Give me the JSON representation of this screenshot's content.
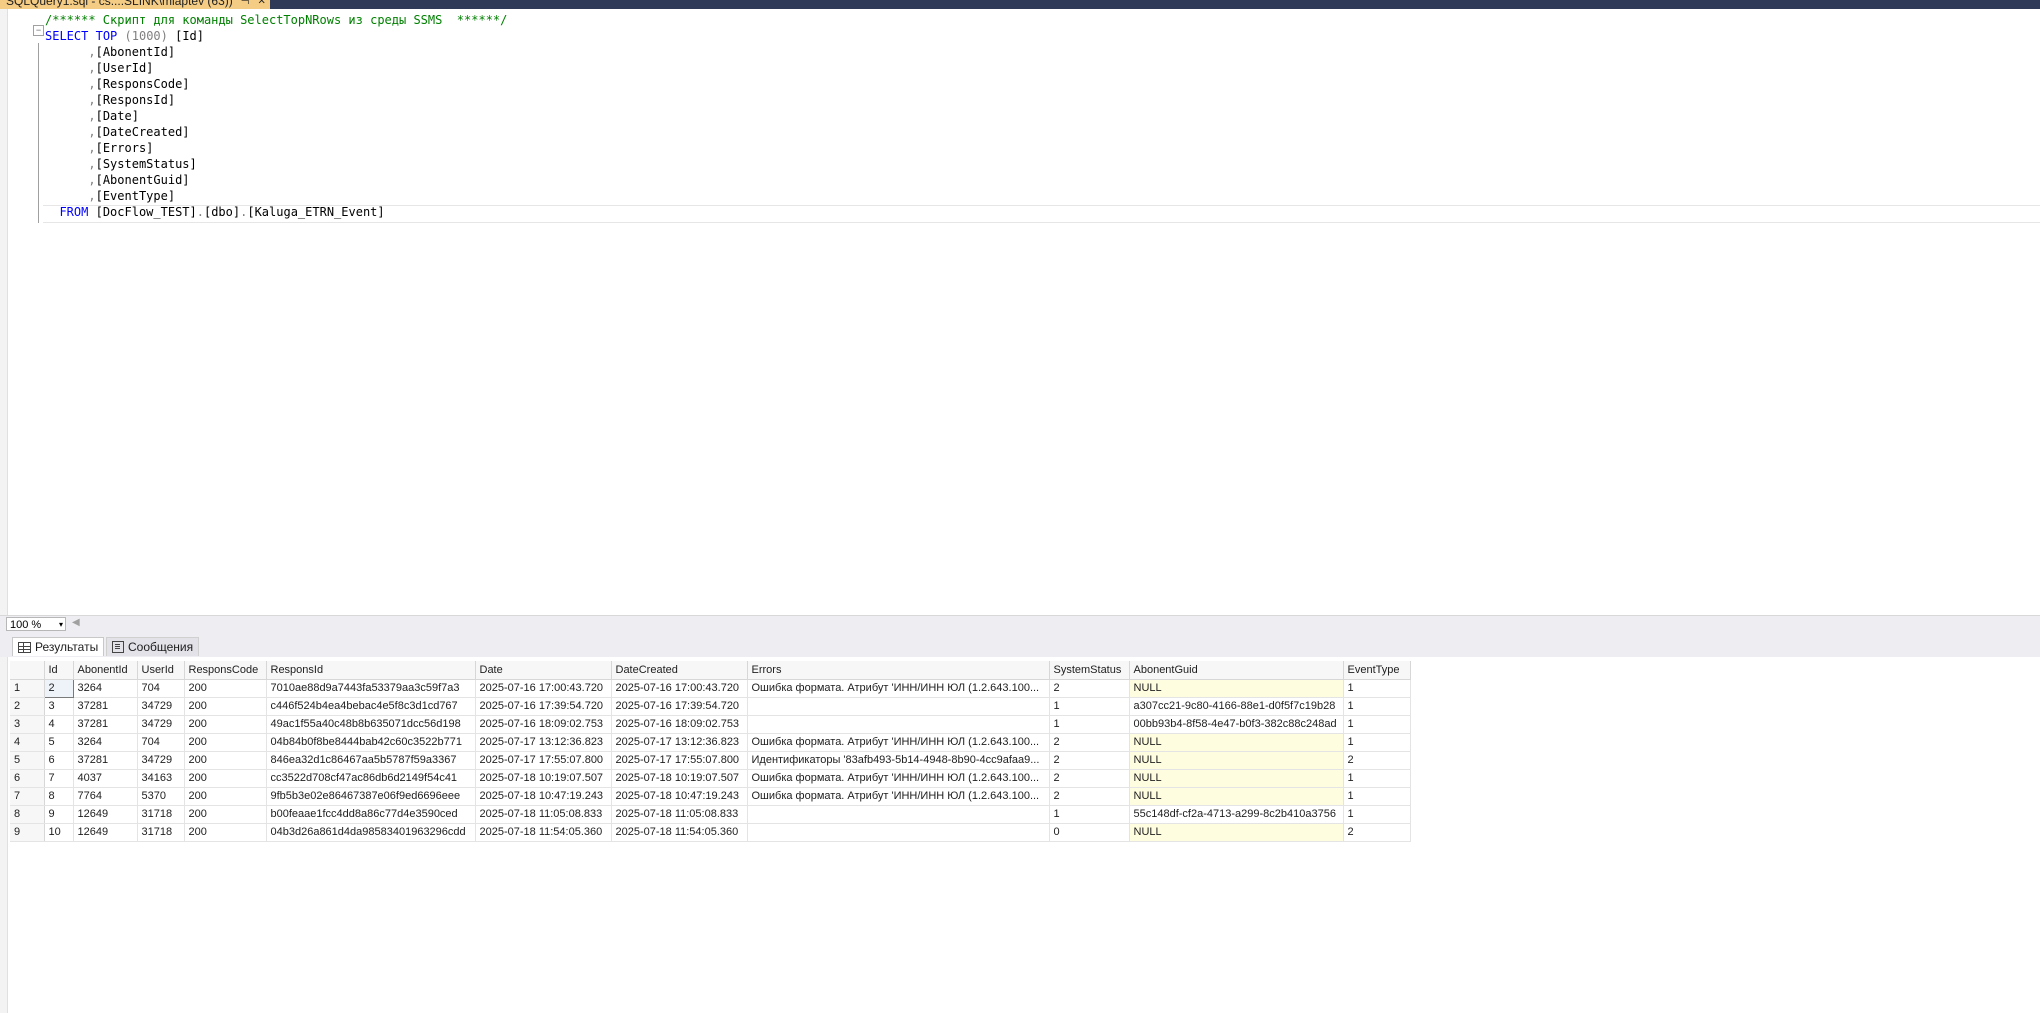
{
  "tab": {
    "title": "SQLQuery1.sql - cs....SLINK\\mlaptev (63))",
    "pin_icon": "pin-icon",
    "close_icon": "close-icon"
  },
  "editor": {
    "comment": "/****** Скрипт для команды SelectTopNRows из среды SSMS  ******/",
    "select_kw": "SELECT",
    "top_kw": "TOP",
    "top_value": "(1000)",
    "first_col": "[Id]",
    "columns": [
      ",[AbonentId]",
      ",[UserId]",
      ",[ResponsCode]",
      ",[ResponsId]",
      ",[Date]",
      ",[DateCreated]",
      ",[Errors]",
      ",[SystemStatus]",
      ",[AbonentGuid]",
      ",[EventType]"
    ],
    "from_kw": "FROM",
    "from_db": "[DocFlow_TEST]",
    "dot1": ".",
    "from_schema": "[dbo]",
    "dot2": ".",
    "from_table": "[Kaluga_ETRN_Event]",
    "collapse_glyph": "⊟"
  },
  "zoom": {
    "value": "100 %",
    "arrow": "▾",
    "scroll_arrow": "◀"
  },
  "result_tabs": {
    "results": "Результаты",
    "messages": "Сообщения"
  },
  "grid": {
    "headers": [
      "Id",
      "AbonentId",
      "UserId",
      "ResponsCode",
      "ResponsId",
      "Date",
      "DateCreated",
      "Errors",
      "SystemStatus",
      "AbonentGuid",
      "EventType"
    ],
    "rows": [
      {
        "n": "1",
        "id": "2",
        "abonent": "3264",
        "user": "704",
        "code": "200",
        "rid": "7010ae88d9a7443fa53379aa3c59f7a3",
        "date": "2025-07-16 17:00:43.720",
        "created": "2025-07-16 17:00:43.720",
        "errors": "Ошибка формата. Атрибут 'ИНН/ИНН ЮЛ (1.2.643.100...",
        "status": "2",
        "guid": "NULL",
        "type": "1"
      },
      {
        "n": "2",
        "id": "3",
        "abonent": "37281",
        "user": "34729",
        "code": "200",
        "rid": "c446f524b4ea4bebac4e5f8c3d1cd767",
        "date": "2025-07-16 17:39:54.720",
        "created": "2025-07-16 17:39:54.720",
        "errors": "",
        "status": "1",
        "guid": "a307cc21-9c80-4166-88e1-d0f5f7c19b28",
        "type": "1"
      },
      {
        "n": "3",
        "id": "4",
        "abonent": "37281",
        "user": "34729",
        "code": "200",
        "rid": "49ac1f55a40c48b8b635071dcc56d198",
        "date": "2025-07-16 18:09:02.753",
        "created": "2025-07-16 18:09:02.753",
        "errors": "",
        "status": "1",
        "guid": "00bb93b4-8f58-4e47-b0f3-382c88c248ad",
        "type": "1"
      },
      {
        "n": "4",
        "id": "5",
        "abonent": "3264",
        "user": "704",
        "code": "200",
        "rid": "04b84b0f8be8444bab42c60c3522b771",
        "date": "2025-07-17 13:12:36.823",
        "created": "2025-07-17 13:12:36.823",
        "errors": "Ошибка формата. Атрибут 'ИНН/ИНН ЮЛ (1.2.643.100...",
        "status": "2",
        "guid": "NULL",
        "type": "1"
      },
      {
        "n": "5",
        "id": "6",
        "abonent": "37281",
        "user": "34729",
        "code": "200",
        "rid": "846ea32d1c86467aa5b5787f59a3367",
        "date": "2025-07-17 17:55:07.800",
        "created": "2025-07-17 17:55:07.800",
        "errors": "Идентификаторы '83afb493-5b14-4948-8b90-4cc9afaa9...",
        "status": "2",
        "guid": "NULL",
        "type": "2"
      },
      {
        "n": "6",
        "id": "7",
        "abonent": "4037",
        "user": "34163",
        "code": "200",
        "rid": "cc3522d708cf47ac86db6d2149f54c41",
        "date": "2025-07-18 10:19:07.507",
        "created": "2025-07-18 10:19:07.507",
        "errors": "Ошибка формата. Атрибут 'ИНН/ИНН ЮЛ (1.2.643.100...",
        "status": "2",
        "guid": "NULL",
        "type": "1"
      },
      {
        "n": "7",
        "id": "8",
        "abonent": "7764",
        "user": "5370",
        "code": "200",
        "rid": "9fb5b3e02e86467387e06f9ed6696eee",
        "date": "2025-07-18 10:47:19.243",
        "created": "2025-07-18 10:47:19.243",
        "errors": "Ошибка формата. Атрибут 'ИНН/ИНН ЮЛ (1.2.643.100...",
        "status": "2",
        "guid": "NULL",
        "type": "1"
      },
      {
        "n": "8",
        "id": "9",
        "abonent": "12649",
        "user": "31718",
        "code": "200",
        "rid": "b00feaae1fcc4dd8a86c77d4e3590ced",
        "date": "2025-07-18 11:05:08.833",
        "created": "2025-07-18 11:05:08.833",
        "errors": "",
        "status": "1",
        "guid": "55c148df-cf2a-4713-a299-8c2b410a3756",
        "type": "1"
      },
      {
        "n": "9",
        "id": "10",
        "abonent": "12649",
        "user": "31718",
        "code": "200",
        "rid": "04b3d26a861d4da98583401963296cdd",
        "date": "2025-07-18 11:54:05.360",
        "created": "2025-07-18 11:54:05.360",
        "errors": "",
        "status": "0",
        "guid": "NULL",
        "type": "2"
      }
    ]
  },
  "colors": {
    "tab_bg": "#f5cc84",
    "tabstrip_bg": "#2e3a57",
    "keyword": "#0000ff",
    "comment": "#008000",
    "null_cell": "#fffde0"
  }
}
